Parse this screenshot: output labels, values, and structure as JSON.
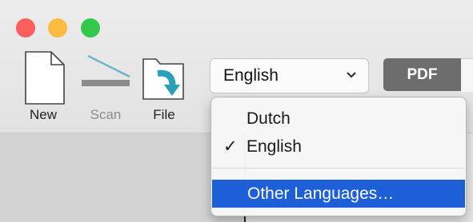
{
  "window": {
    "controls": [
      "close",
      "minimize",
      "zoom"
    ]
  },
  "toolbar": {
    "new_label": "New",
    "scan_label": "Scan",
    "file_label": "File",
    "language_value": "English",
    "pdf_label": "PDF"
  },
  "language_menu": {
    "items": [
      {
        "label": "Dutch",
        "checked": false,
        "highlighted": false
      },
      {
        "label": "English",
        "checked": true,
        "highlighted": false
      },
      {
        "label": "Other Languages…",
        "checked": false,
        "highlighted": true
      }
    ],
    "check_glyph": "✓"
  },
  "icons": {
    "new": "document-icon",
    "scan": "scanner-icon",
    "file": "folder-arrow-icon",
    "dropdown": "chevron-down-icon"
  },
  "colors": {
    "close": "#fc605c",
    "minimize": "#fdbc40",
    "zoom": "#34c84a",
    "accent": "#1d5fd7",
    "file_arrow": "#2a9fb8",
    "pdf_button": "#6d6d6d"
  }
}
